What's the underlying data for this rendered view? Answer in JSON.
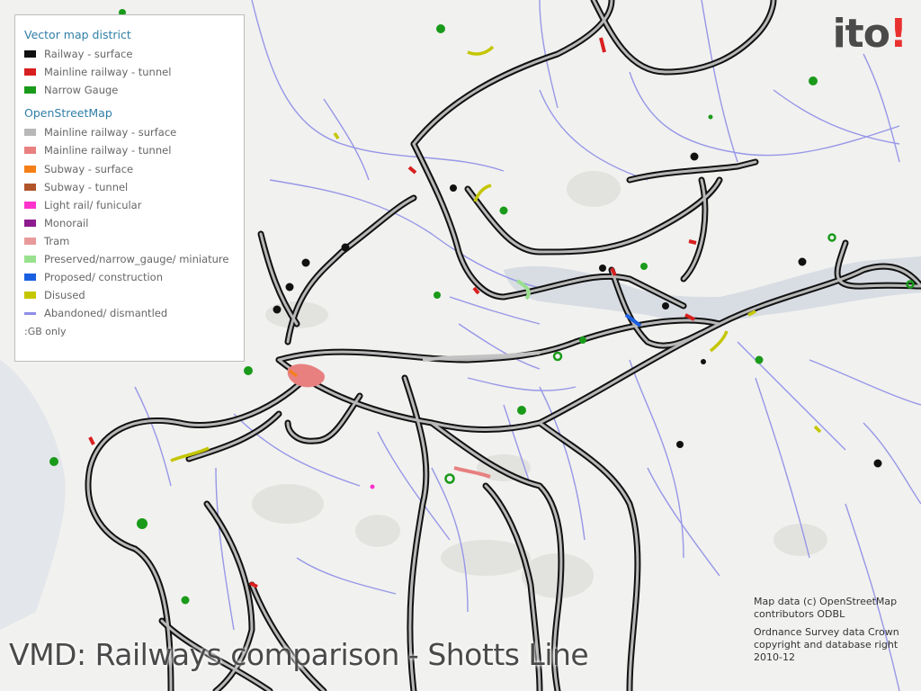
{
  "brand": {
    "text": "ito",
    "mark": "!",
    "accent": "#e8312f"
  },
  "legend": {
    "vector_title": "Vector map district",
    "vector_items": [
      {
        "label": "Railway - surface",
        "color": "#111111"
      },
      {
        "label": "Mainline railway - tunnel",
        "color": "#d81f1f"
      },
      {
        "label": "Narrow Gauge",
        "color": "#1a9a1a"
      }
    ],
    "osm_title": "OpenStreetMap",
    "osm_items": [
      {
        "label": "Mainline railway - surface",
        "color": "#b8b8b8"
      },
      {
        "label": "Mainline railway - tunnel",
        "color": "#e88080"
      },
      {
        "label": "Subway - surface",
        "color": "#f57f17"
      },
      {
        "label": "Subway - tunnel",
        "color": "#b0552a"
      },
      {
        "label": "Light rail/ funicular",
        "color": "#ff33cc"
      },
      {
        "label": "Monorail",
        "color": "#8e1b8e"
      },
      {
        "label": "Tram",
        "color": "#e89a9a"
      },
      {
        "label": "Preserved/narrow_gauge/ miniature",
        "color": "#99e08f"
      },
      {
        "label": "Proposed/ construction",
        "color": "#1a5fe0"
      },
      {
        "label": "Disused",
        "color": "#c4c600"
      },
      {
        "label": "Abandoned/ dismantled",
        "color": "#8e8ee8"
      }
    ],
    "note": ":GB only"
  },
  "attribution": {
    "line1": "Map data (c) OpenStreetMap contributors ODBL",
    "line2": "Ordnance Survey data Crown copyright and database right 2010-12"
  },
  "caption": "VMD: Railways comparison - Shotts Line",
  "colors": {
    "background": "#f1f1ef",
    "water": "#d8dde3",
    "land_tint": "#e2e3df",
    "rail_outline": "#111111",
    "rail_fill": "#b8b8b8",
    "abandoned": "#8e8ee8",
    "tunnel": "#d81f1f",
    "disused": "#c4c600",
    "narrow_gauge": "#1a9a1a"
  }
}
